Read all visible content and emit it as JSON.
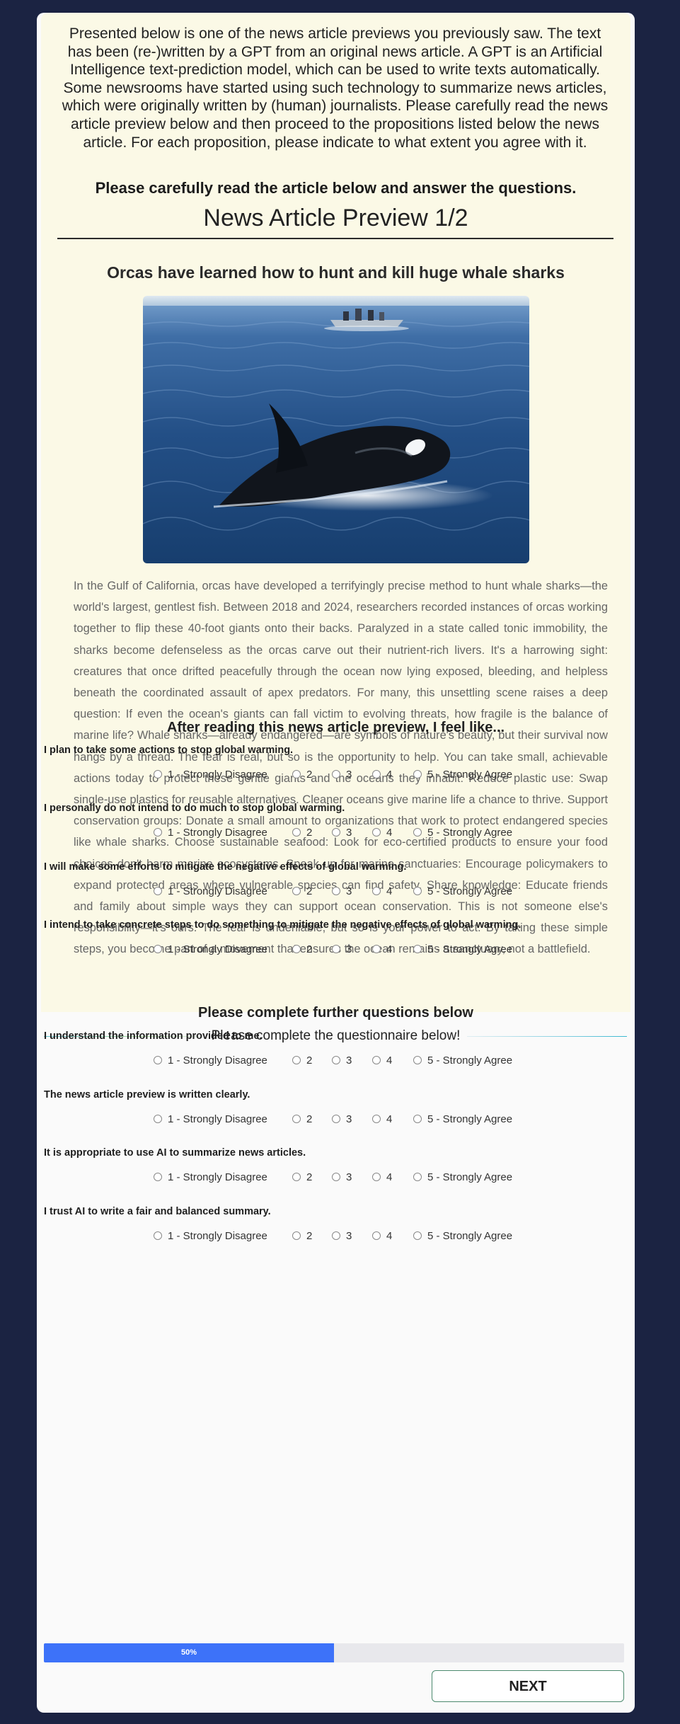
{
  "intro_text": "Presented below is one of the news article previews you previously saw. The text has been (re-)written by a GPT from an original news article. A GPT is an Artificial Intelligence text-prediction model, which can be used to write texts automatically. Some newsrooms have started using such technology to summarize news articles, which were originally written by (human) journalists. Please carefully read the news article preview below and then proceed to the propositions listed below the news article. For each proposition, please indicate to what extent you agree with it.",
  "instruction": "Please carefully read the article below and answer the questions.",
  "preview_title": "News Article Preview 1/2",
  "article": {
    "headline": "Orcas have learned how to hunt and kill huge whale sharks",
    "image_icon": "orca-photo",
    "body": "In the Gulf of California, orcas have developed a terrifyingly precise method to hunt whale sharks—the world's largest, gentlest fish. Between 2018 and 2024, researchers recorded instances of orcas working together to flip these 40-foot giants onto their backs. Paralyzed in a state called tonic immobility, the sharks become defenseless as the orcas carve out their nutrient-rich livers. It's a harrowing sight: creatures that once drifted peacefully through the ocean now lying exposed, bleeding, and helpless beneath the coordinated assault of apex predators. For many, this unsettling scene raises a deep question: If even the ocean's giants can fall victim to evolving threats, how fragile is the balance of marine life? Whale sharks—already endangered—are symbols of nature's beauty, but their survival now hangs by a thread. The fear is real, but so is the opportunity to help. You can take small, achievable actions today to protect these gentle giants and the oceans they inhabit: Reduce plastic use: Swap single-use plastics for reusable alternatives. Cleaner oceans give marine life a chance to thrive. Support conservation groups: Donate a small amount to organizations that work to protect endangered species like whale sharks. Choose sustainable seafood: Look for eco-certified products to ensure your food choices don't harm marine ecosystems. Speak up for marine sanctuaries: Encourage policymakers to expand protected areas where vulnerable species can find safety. Share knowledge: Educate friends and family about simple ways they can support ocean conservation. This is not someone else's responsibility—it's ours. The fear is undeniable, but so is your power to act. By taking these simple steps, you become part of a movement that ensures the ocean remains a sanctuary, not a battlefield."
  },
  "questionnaire_header": "Please complete the questionnaire below!",
  "scale_options": [
    "1 - Strongly Disagree",
    "2",
    "3",
    "4",
    "5 - Strongly Agree"
  ],
  "section1": {
    "title": "After reading this news article preview, I feel like...",
    "questions": [
      "I plan to take some actions to stop global warming.",
      "I personally do not intend to do much to stop global warming.",
      "I will make some efforts to mitigate the negative effects of global warming.",
      "I intend to take concrete steps to do something to mitigate the negative effects of global warming."
    ]
  },
  "section2": {
    "title": "Please complete further questions below",
    "questions": [
      "I understand the information provided to me.",
      "The news article preview is written clearly.",
      "It is appropriate to use AI to summarize news articles.",
      "I trust AI to write a fair and balanced summary."
    ]
  },
  "progress": {
    "percent": 50,
    "label": "50%"
  },
  "next_label": "NEXT",
  "colors": {
    "background": "#1b2342",
    "panel": "#fbf9e6",
    "progress": "#3d72f9"
  }
}
